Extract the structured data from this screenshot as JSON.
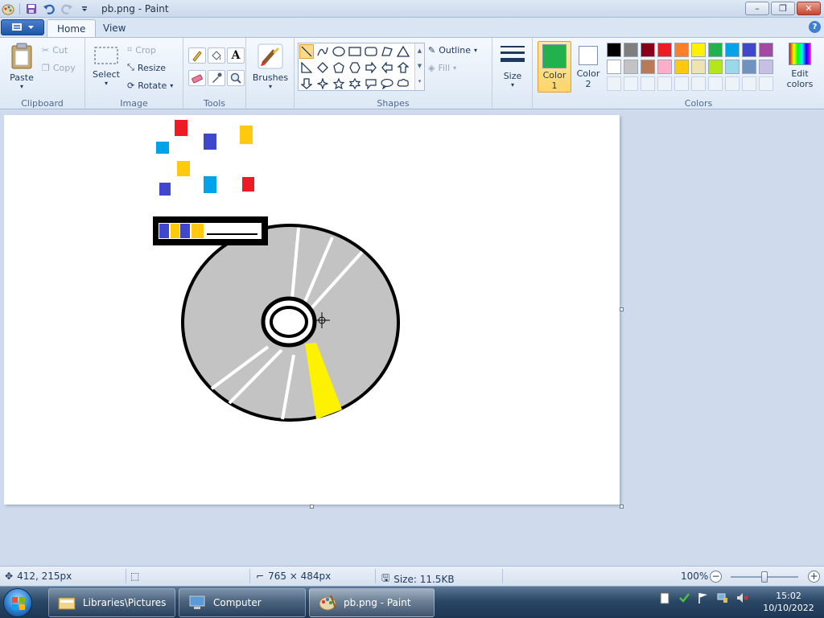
{
  "window": {
    "title": "pb.png - Paint",
    "minimize": "–",
    "maximize": "❐",
    "close": "✕"
  },
  "tabs": {
    "home": "Home",
    "view": "View",
    "help": "?"
  },
  "ribbon": {
    "clipboard": {
      "label": "Clipboard",
      "paste": "Paste",
      "cut": "Cut",
      "copy": "Copy"
    },
    "image": {
      "label": "Image",
      "select": "Select",
      "crop": "Crop",
      "resize": "Resize",
      "rotate": "Rotate"
    },
    "tools": {
      "label": "Tools",
      "text_glyph": "A"
    },
    "brushes": {
      "label": "Brushes"
    },
    "shapes": {
      "label": "Shapes",
      "outline": "Outline",
      "fill": "Fill"
    },
    "size": {
      "label": "Size"
    },
    "color1": {
      "label1": "Color",
      "label2": "1",
      "value": "#22b14c"
    },
    "color2": {
      "label1": "Color",
      "label2": "2",
      "value": "#ffffff"
    },
    "colors": {
      "label": "Colors",
      "edit1": "Edit",
      "edit2": "colors",
      "row1": [
        "#000000",
        "#7f7f7f",
        "#880015",
        "#ed1c24",
        "#ff7f27",
        "#fff200",
        "#22b14c",
        "#00a2e8",
        "#3f48cc",
        "#a349a4"
      ],
      "row2": [
        "#ffffff",
        "#c3c3c3",
        "#b97a57",
        "#ffaec9",
        "#ffc90e",
        "#efe4b0",
        "#b5e61d",
        "#99d9ea",
        "#7092be",
        "#c8bfe7"
      ]
    }
  },
  "status": {
    "cursor_pos": "412, 215px",
    "canvas_size": "765 × 484px",
    "file_size": "Size: 11.5KB",
    "zoom": "100%",
    "zoom_level": 1.0
  },
  "taskbar": {
    "items": [
      "Libraries\\Pictures",
      "Computer",
      "pb.png - Paint"
    ],
    "time": "15:02",
    "date": "10/10/2022"
  },
  "drawing": {
    "disc_fill": "#c3c3c3",
    "outline": "#000000",
    "highlight": "#fff200",
    "confetti": [
      "#ed1c24",
      "#00a2e8",
      "#3f48cc",
      "#ffc90e"
    ]
  }
}
